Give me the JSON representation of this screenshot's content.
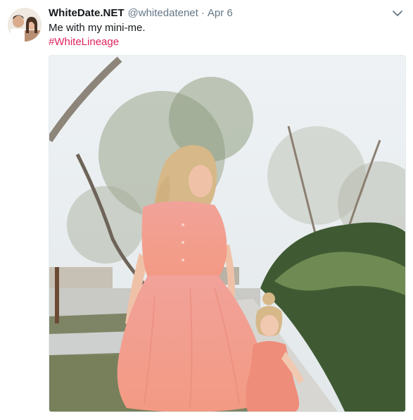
{
  "tweet": {
    "display_name": "WhiteDate.NET",
    "handle": "@whitedatenet",
    "separator": "·",
    "timestamp": "Apr 6",
    "text": "Me with my mini-me.",
    "hashtag": "#WhiteLineage"
  },
  "icons": {
    "avatar": "profile-photo",
    "caret": "chevron-down-icon"
  },
  "colors": {
    "text": "#14171a",
    "secondary": "#657786",
    "hashtag": "#e0245e",
    "border": "#e6ecf0"
  }
}
